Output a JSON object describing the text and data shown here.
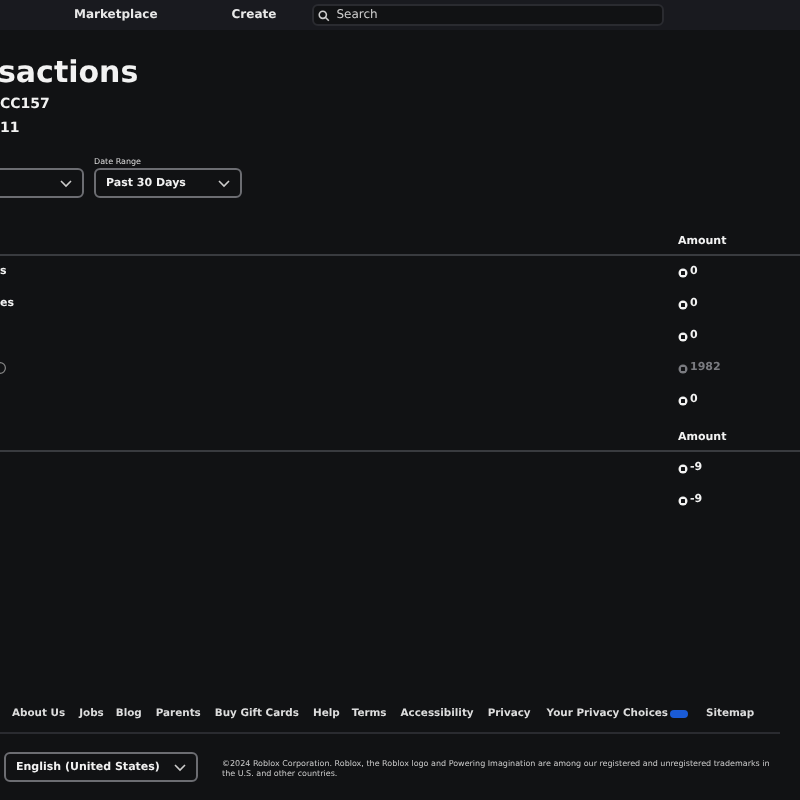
{
  "header": {
    "nav": [
      "Marketplace",
      "Create"
    ],
    "search": {
      "placeholder": "Search"
    }
  },
  "title": "sactions",
  "summary": [
    "CC157",
    "11"
  ],
  "filters": [
    {
      "kind": "select"
    },
    {
      "kind": "select",
      "label": "Date Range",
      "value": "Past 30 Days"
    }
  ],
  "tables": [
    {
      "column": "Amount",
      "rows": [
        {
          "label": "s",
          "amount": "0",
          "muted": false
        },
        {
          "label": "es",
          "amount": "0",
          "muted": false
        },
        {
          "amount": "0",
          "muted": false
        },
        {
          "amount": "1982",
          "muted": true
        },
        {
          "amount": "0",
          "muted": false
        }
      ]
    },
    {
      "column": "Amount",
      "rows": [
        {
          "amount": "-9",
          "muted": false
        },
        {
          "amount": "-9",
          "muted": false
        }
      ]
    }
  ],
  "footer": {
    "links": [
      "About Us",
      "Jobs",
      "Blog",
      "Parents",
      "Buy Gift Cards",
      "Help",
      "Terms",
      "Accessibility",
      "Privacy",
      "Your Privacy Choices",
      "Sitemap"
    ],
    "language": "English (United States)",
    "copyright": "©2024 Roblox Corporation. Roblox, the Roblox logo and Powering Imagination are among our registered and unregistered trademarks in the U.S. and other countries."
  }
}
